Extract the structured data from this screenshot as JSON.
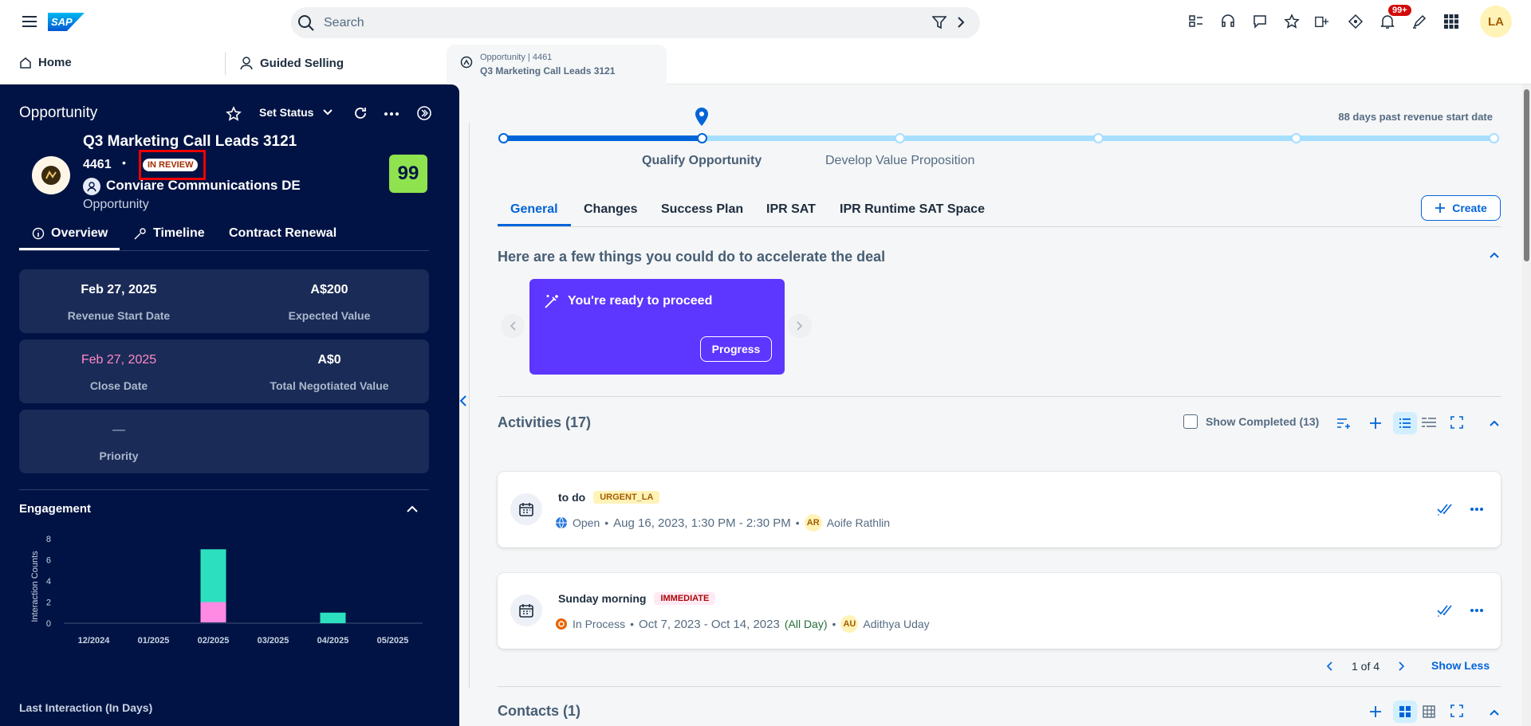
{
  "shell": {
    "logo": "SAP",
    "search_placeholder": "Search",
    "notification_badge": "99+",
    "avatar_initials": "LA"
  },
  "tabs": {
    "home": "Home",
    "guided_selling": "Guided Selling",
    "opp_line1": "Opportunity | 4461",
    "opp_line2": "Q3 Marketing Call Leads 3121"
  },
  "left": {
    "header": "Opportunity",
    "set_status": "Set Status",
    "name": "Q3 Marketing Call Leads 3121",
    "id": "4461",
    "status": "IN REVIEW",
    "account": "Conviare Communications DE",
    "type": "Opportunity",
    "score": "99",
    "subtabs": [
      "Overview",
      "Timeline",
      "Contract Renewal"
    ],
    "kpis": {
      "revenue_start_value": "Feb 27, 2025",
      "revenue_start_label": "Revenue Start Date",
      "expected_value": "A$200",
      "expected_label": "Expected Value",
      "close_date_value": "Feb 27, 2025",
      "close_date_label": "Close Date",
      "tnv_value": "A$0",
      "tnv_label": "Total Negotiated Value",
      "priority_value": "—",
      "priority_label": "Priority"
    },
    "engagement_title": "Engagement",
    "last_interaction": "Last Interaction (In Days)"
  },
  "chart_data": {
    "type": "bar",
    "ylabel": "Interaction Counts",
    "ylim": [
      0,
      8
    ],
    "yticks": [
      "0",
      "2",
      "4",
      "6",
      "8"
    ],
    "categories": [
      "12/2024",
      "01/2025",
      "02/2025",
      "03/2025",
      "04/2025",
      "05/2025"
    ],
    "series": [
      {
        "values": [
          0,
          0,
          2,
          0,
          0,
          0
        ],
        "color": "#ff8ae4"
      },
      {
        "values": [
          0,
          0,
          5,
          0,
          1,
          0
        ],
        "color": "#2ce0bf"
      }
    ],
    "stacked": true
  },
  "main": {
    "past_due": "88 days past revenue start date",
    "stages": [
      "Qualify Opportunity",
      "Develop Value Proposition"
    ],
    "tabs": [
      "General",
      "Changes",
      "Success Plan",
      "IPR SAT",
      "IPR Runtime SAT Space"
    ],
    "create": "Create",
    "accelerate_title": "Here are a few things you could do to accelerate the deal",
    "promo_title": "You're ready to proceed",
    "promo_button": "Progress",
    "activities_title": "Activities (17)",
    "show_completed": "Show Completed (13)",
    "activities": [
      {
        "title": "to do",
        "tag": "URGENT_LA",
        "status": "Open",
        "date": "Aug 16, 2023, 1:30 PM - 2:30 PM",
        "initials": "AR",
        "owner": "Aoife Rathlin"
      },
      {
        "title": "Sunday morning",
        "tag": "IMMEDIATE",
        "status": "In Process",
        "date": "Oct 7, 2023 - Oct 14, 2023",
        "allday": "(All Day)",
        "initials": "AU",
        "owner": "Adithya Uday"
      }
    ],
    "pager": "1 of 4",
    "show_less": "Show Less",
    "contacts_title": "Contacts (1)"
  },
  "colors": {
    "accent": "#0064d9",
    "panel": "#011344",
    "promo": "#5d36ff",
    "score": "#8ee34f"
  }
}
